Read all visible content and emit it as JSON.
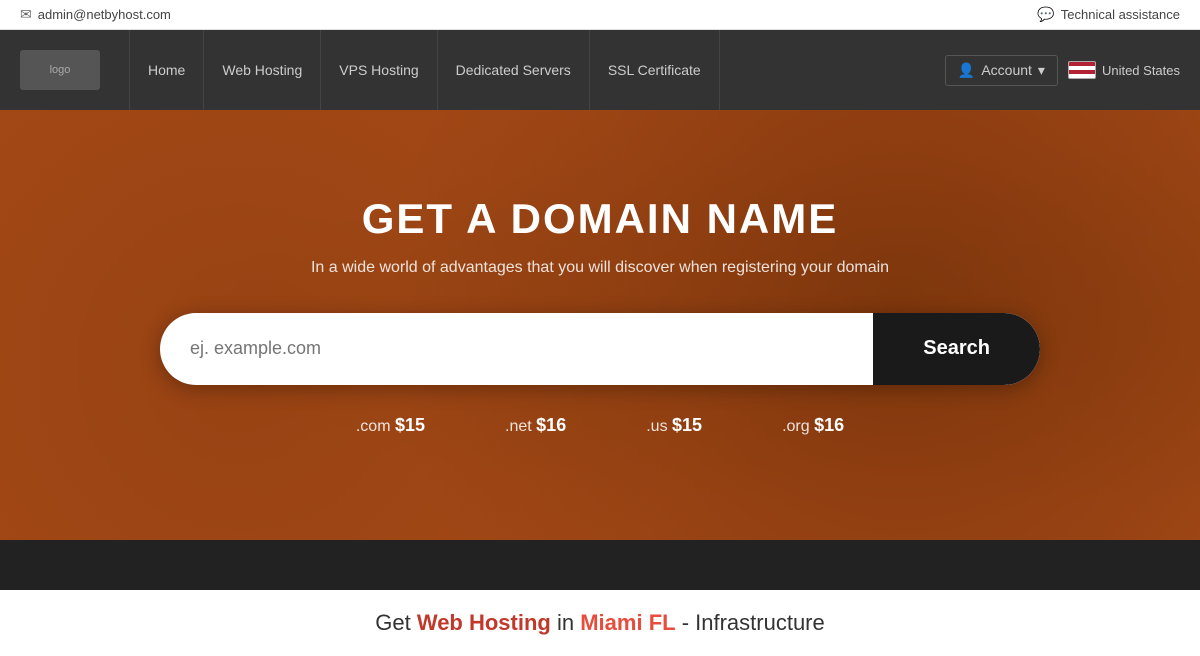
{
  "topbar": {
    "email": "admin@netbyhost.com",
    "technical_assistance": "Technical assistance"
  },
  "nav": {
    "logo_alt": "logo",
    "items": [
      {
        "label": "Home",
        "id": "home"
      },
      {
        "label": "Web Hosting",
        "id": "web-hosting"
      },
      {
        "label": "VPS Hosting",
        "id": "vps-hosting"
      },
      {
        "label": "Dedicated Servers",
        "id": "dedicated-servers"
      },
      {
        "label": "SSL Certificate",
        "id": "ssl-certificate"
      }
    ],
    "account_label": "Account",
    "country_label": "United States"
  },
  "hero": {
    "title": "GET A DOMAIN NAME",
    "subtitle": "In a wide world of advantages that you will discover when registering your domain",
    "search_placeholder": "ej. example.com",
    "search_button_label": "Search",
    "pricing": [
      {
        "ext": ".com",
        "price": "$15"
      },
      {
        "ext": ".net",
        "price": "$16"
      },
      {
        "ext": ".us",
        "price": "$15"
      },
      {
        "ext": ".org",
        "price": "$16"
      }
    ]
  },
  "bottom": {
    "teaser_prefix": "Get",
    "teaser_highlight1": "Web Hosting",
    "teaser_middle": "in",
    "teaser_highlight2": "Miami FL",
    "teaser_suffix": "- Infrastructure"
  }
}
